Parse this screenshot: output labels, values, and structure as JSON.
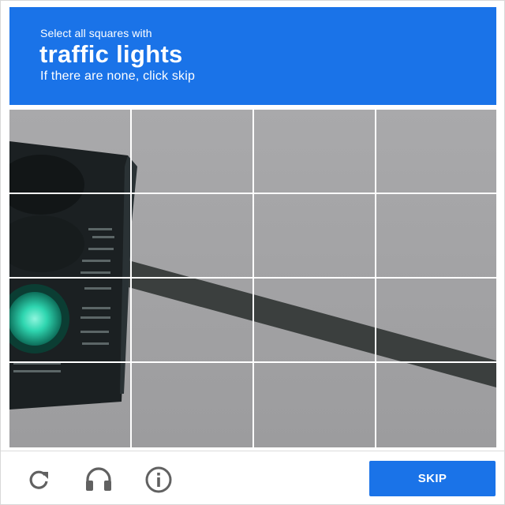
{
  "header": {
    "instruction": "Select all squares with",
    "target": "traffic lights",
    "hint": "If there are none, click skip",
    "background_color": "#1a73e8"
  },
  "grid": {
    "rows": 4,
    "columns": 4,
    "selected_tiles": []
  },
  "footer": {
    "icons": [
      "reload-icon",
      "audio-icon",
      "info-icon"
    ],
    "skip_label": "SKIP",
    "accent_color": "#1a73e8"
  }
}
